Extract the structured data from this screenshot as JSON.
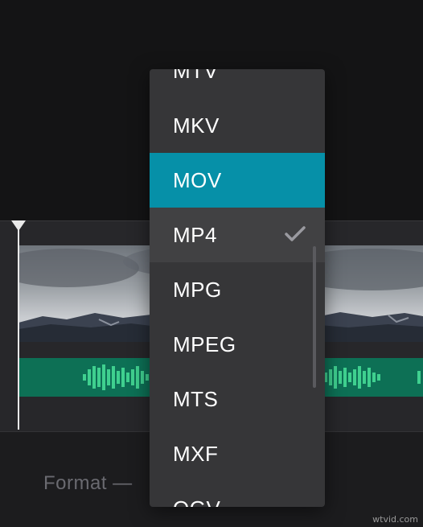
{
  "format_bar": {
    "label": "Format —"
  },
  "format_dropdown": {
    "options": [
      "MTV",
      "MKV",
      "MOV",
      "MP4",
      "MPG",
      "MPEG",
      "MTS",
      "MXF",
      "OGV"
    ],
    "highlighted": "MOV",
    "selected": "MP4"
  },
  "icons": {
    "selected_marker": "check-icon",
    "playhead": "playhead-marker-icon"
  },
  "colors": {
    "highlight": "#0690a8",
    "audio_track": "#0d7055",
    "waveform": "#3fd08f"
  },
  "watermark": "wtvid.com"
}
